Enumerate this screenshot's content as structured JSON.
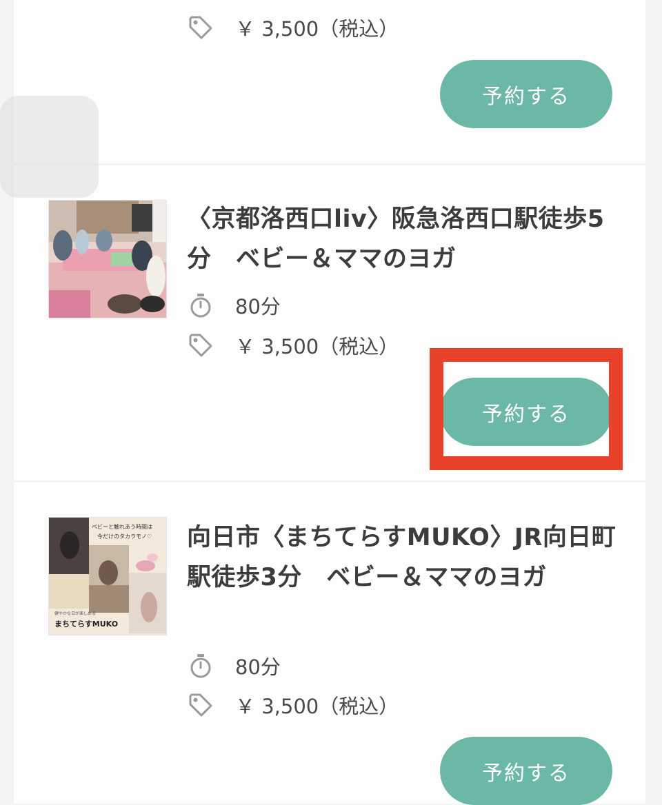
{
  "classes": [
    {
      "title": "",
      "duration": "",
      "price": "￥ 3,500（税込）",
      "book_label": "予約する"
    },
    {
      "title": "〈京都洛西口liv〉阪急洛西口駅徒歩5分　ベビー＆ママのヨガ",
      "duration": "80分",
      "price": "￥ 3,500（税込）",
      "book_label": "予約する",
      "thumb_icon": "photo-yoga-class-icon"
    },
    {
      "title": "向日市〈まちてらすMUKO〉JR向日町駅徒歩3分　ベビー＆ママのヨガ",
      "duration": "80分",
      "price": "￥ 3,500（税込）",
      "book_label": "予約する",
      "thumb_icon": "photo-flyer-icon",
      "thumb_text": {
        "line1": "ベビーと触れあう時間は",
        "line2": "今だけのタカラモノ♡",
        "small": "健やかな日が楽しめる",
        "venue": "まちてらすMUKO"
      }
    }
  ],
  "icons": {
    "duration": "stopwatch-icon",
    "price": "price-tag-icon"
  },
  "colors": {
    "book_button": "#6cb8a6",
    "highlight": "#e8432a",
    "card_bg": "#fdfdfd",
    "page_bg": "#f4f4f4"
  }
}
